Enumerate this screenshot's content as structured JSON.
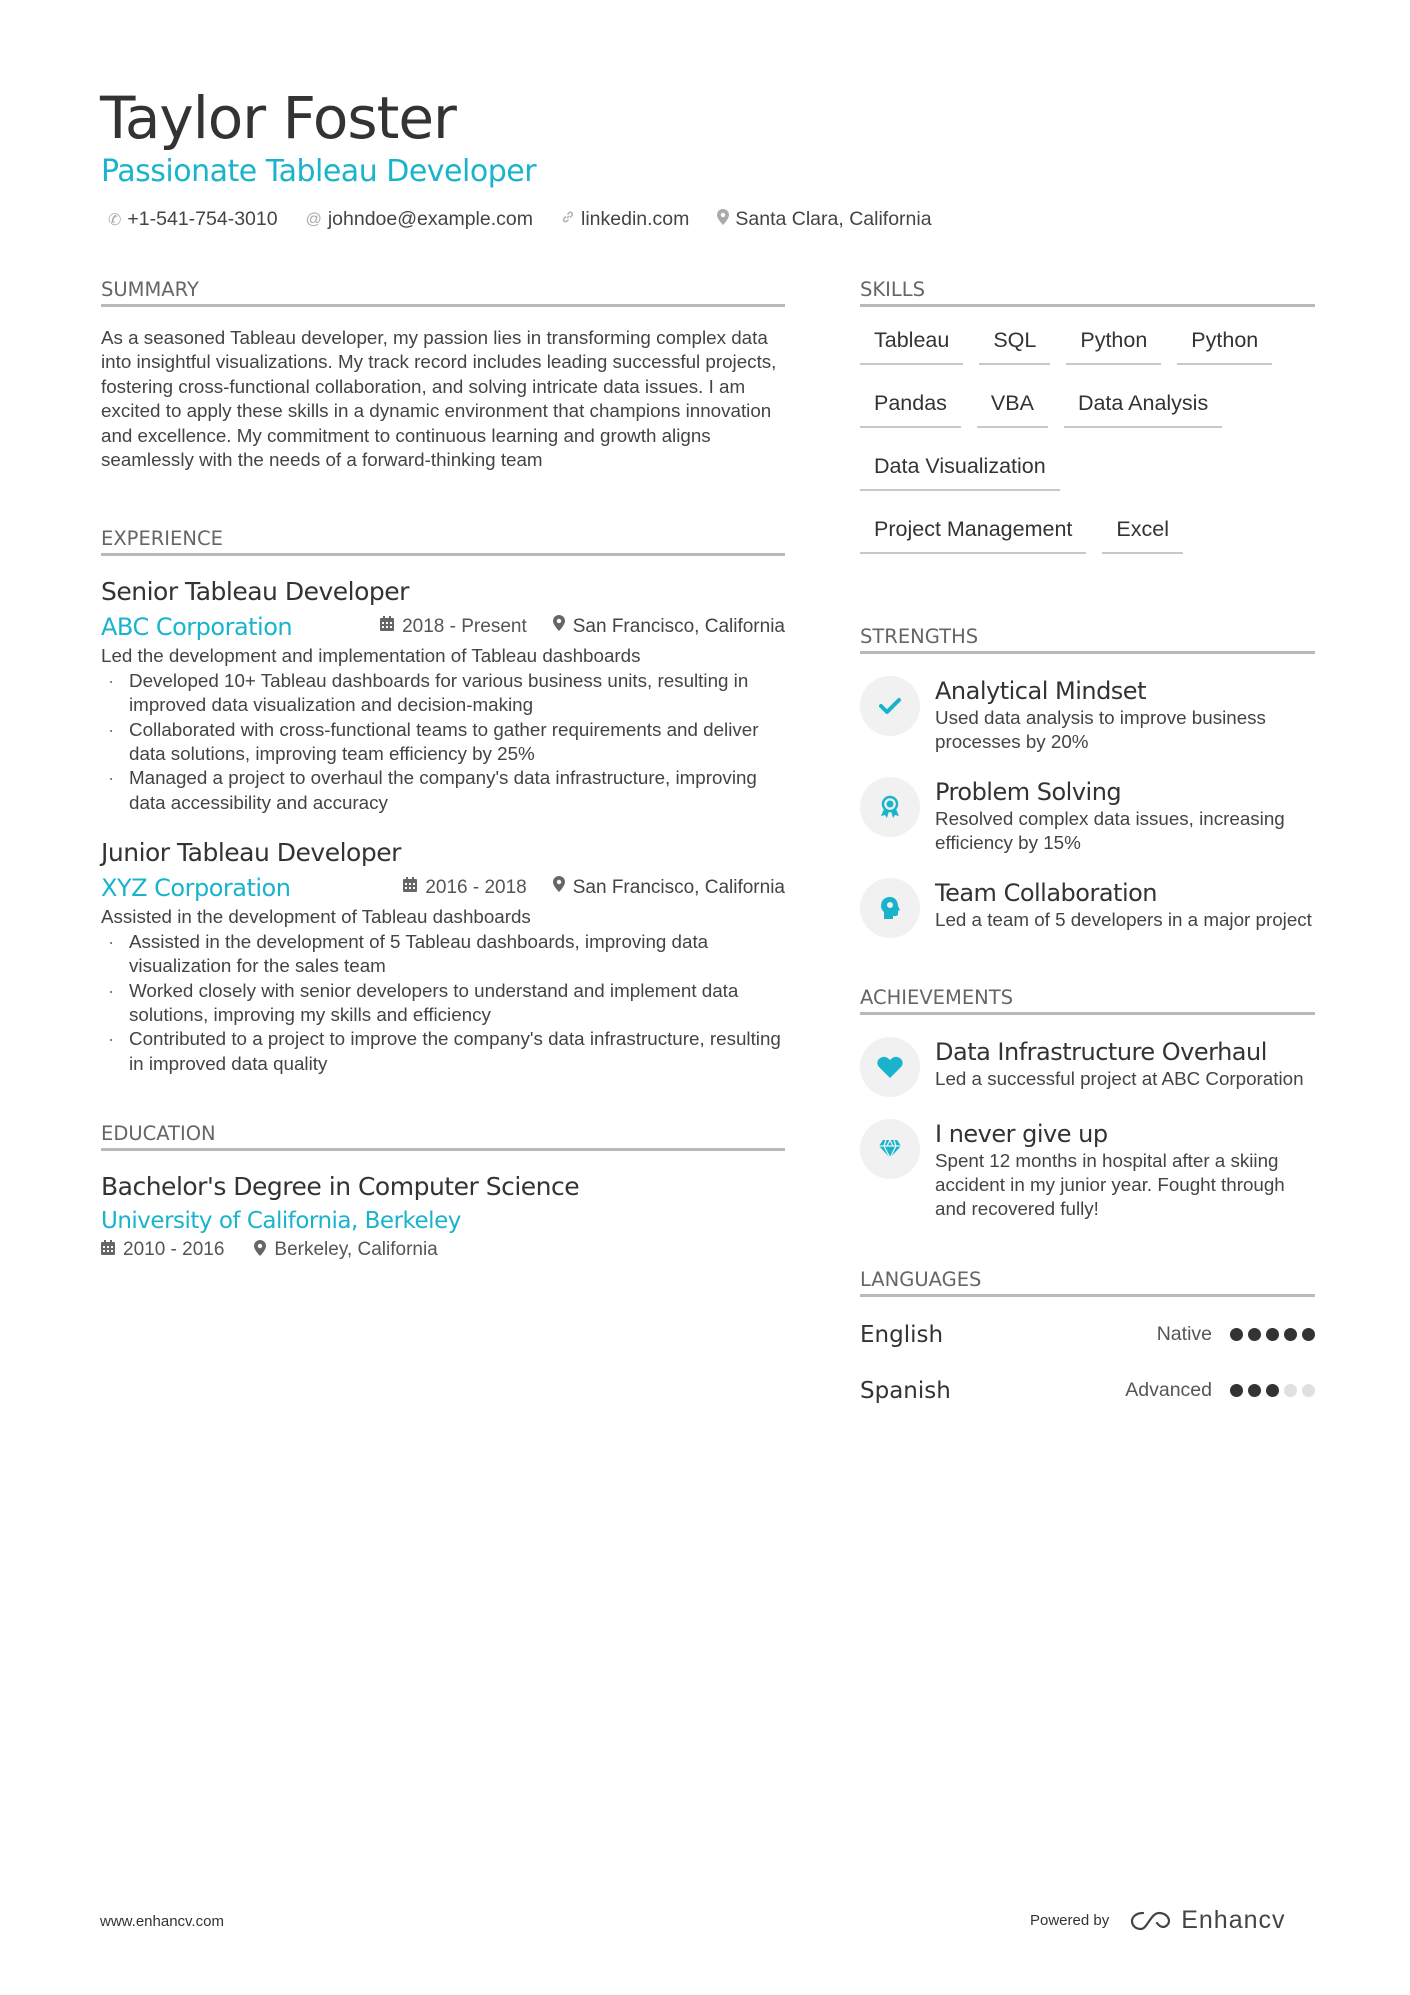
{
  "header": {
    "name": "Taylor Foster",
    "title": "Passionate Tableau Developer",
    "contact": [
      {
        "icon": "phone-icon",
        "glyph": "✆",
        "text": "+1-541-754-3010"
      },
      {
        "icon": "at-icon",
        "glyph": "@",
        "text": "johndoe@example.com"
      },
      {
        "icon": "link-icon",
        "glyph": "🔗",
        "text": "linkedin.com"
      },
      {
        "icon": "location-pin-icon",
        "glyph": "⚲",
        "text": "Santa Clara, California"
      }
    ]
  },
  "colors": {
    "accent": "#19b4cc",
    "text": "#333333",
    "rule": "#b7b9bc",
    "badge_bg": "#f1f1f1"
  },
  "summary": {
    "heading": "SUMMARY",
    "text": "As a seasoned Tableau developer, my passion lies in transforming complex data into insightful visualizations. My track record includes leading successful projects, fostering cross-functional collaboration, and solving intricate data issues. I am excited to apply these skills in a dynamic environment that champions innovation and excellence. My commitment to continuous learning and growth aligns seamlessly with the needs of a forward-thinking team"
  },
  "experience": {
    "heading": "EXPERIENCE",
    "jobs": [
      {
        "role": "Senior Tableau Developer",
        "company": "ABC Corporation",
        "dates": "2018 - Present",
        "location": "San Francisco, California",
        "description": "Led the development and implementation of Tableau dashboards",
        "bullets": [
          "Developed 10+ Tableau dashboards for various business units, resulting in improved data visualization and decision-making",
          "Collaborated with cross-functional teams to gather requirements and deliver data solutions, improving team efficiency by 25%",
          "Managed a project to overhaul the company's data infrastructure, improving data accessibility and accuracy"
        ]
      },
      {
        "role": "Junior Tableau Developer",
        "company": "XYZ Corporation",
        "dates": "2016 - 2018",
        "location": "San Francisco, California",
        "description": "Assisted in the development of Tableau dashboards",
        "bullets": [
          "Assisted in the development of 5 Tableau dashboards, improving data visualization for the sales team",
          "Worked closely with senior developers to understand and implement data solutions, improving my skills and efficiency",
          "Contributed to a project to improve the company's data infrastructure, resulting in improved data quality"
        ]
      }
    ]
  },
  "education": {
    "heading": "EDUCATION",
    "degree": "Bachelor's Degree in Computer Science",
    "school": "University of California, Berkeley",
    "dates": "2010 - 2016",
    "location": "Berkeley, California"
  },
  "skills": {
    "heading": "SKILLS",
    "items": [
      "Tableau",
      "SQL",
      "Python",
      "Python",
      "Pandas",
      "VBA",
      "Data Analysis",
      "Data Visualization",
      "Project Management",
      "Excel"
    ]
  },
  "strengths": {
    "heading": "STRENGTHS",
    "items": [
      {
        "icon": "checkmark-icon",
        "title": "Analytical Mindset",
        "desc": "Used data analysis to improve business processes by 20%"
      },
      {
        "icon": "award-ribbon-icon",
        "title": "Problem Solving",
        "desc": "Resolved complex data issues, increasing efficiency by 15%"
      },
      {
        "icon": "head-brain-icon",
        "title": "Team Collaboration",
        "desc": "Led a team of 5 developers in a major project"
      }
    ]
  },
  "achievements": {
    "heading": "ACHIEVEMENTS",
    "items": [
      {
        "icon": "heart-icon",
        "title": "Data Infrastructure Overhaul",
        "desc": "Led a successful project at ABC Corporation"
      },
      {
        "icon": "diamond-icon",
        "title": "I never give up",
        "desc": "Spent 12 months in hospital after a skiing accident in my junior year. Fought through and recovered fully!"
      }
    ]
  },
  "languages": {
    "heading": "LANGUAGES",
    "items": [
      {
        "name": "English",
        "level": "Native",
        "rating": 5,
        "max": 5
      },
      {
        "name": "Spanish",
        "level": "Advanced",
        "rating": 3,
        "max": 5
      }
    ]
  },
  "footer": {
    "website": "www.enhancv.com",
    "powered_by": "Powered by",
    "brand": "Enhancv"
  }
}
